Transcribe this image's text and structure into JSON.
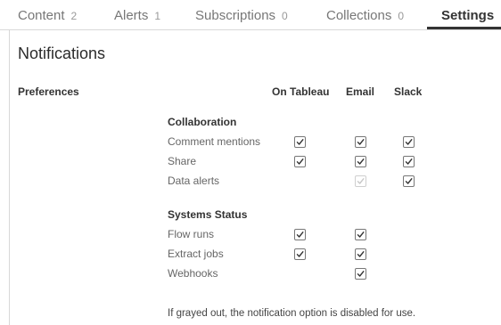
{
  "tabs": [
    {
      "label": "Content",
      "count": "2"
    },
    {
      "label": "Alerts",
      "count": "1"
    },
    {
      "label": "Subscriptions",
      "count": "0"
    },
    {
      "label": "Collections",
      "count": "0"
    },
    {
      "label": "Settings",
      "count": ""
    }
  ],
  "active_tab": "Settings",
  "page_title": "Notifications",
  "section_label": "Preferences",
  "columns": [
    "On Tableau",
    "Email",
    "Slack"
  ],
  "groups": [
    {
      "title": "Collaboration",
      "rows": [
        {
          "label": "Comment mentions",
          "on_tableau": "checked",
          "email": "checked",
          "slack": "checked"
        },
        {
          "label": "Share",
          "on_tableau": "checked",
          "email": "checked",
          "slack": "checked"
        },
        {
          "label": "Data alerts",
          "on_tableau": "none",
          "email": "disabled",
          "slack": "checked"
        }
      ]
    },
    {
      "title": "Systems Status",
      "rows": [
        {
          "label": "Flow runs",
          "on_tableau": "checked",
          "email": "checked",
          "slack": "none"
        },
        {
          "label": "Extract jobs",
          "on_tableau": "checked",
          "email": "checked",
          "slack": "none"
        },
        {
          "label": "Webhooks",
          "on_tableau": "none",
          "email": "checked",
          "slack": "none"
        }
      ]
    }
  ],
  "footnote": "If grayed out, the notification option is disabled for use.",
  "colors": {
    "check": "#333333",
    "check_disabled": "#c8c8c8",
    "tab_underline": "#333333"
  }
}
